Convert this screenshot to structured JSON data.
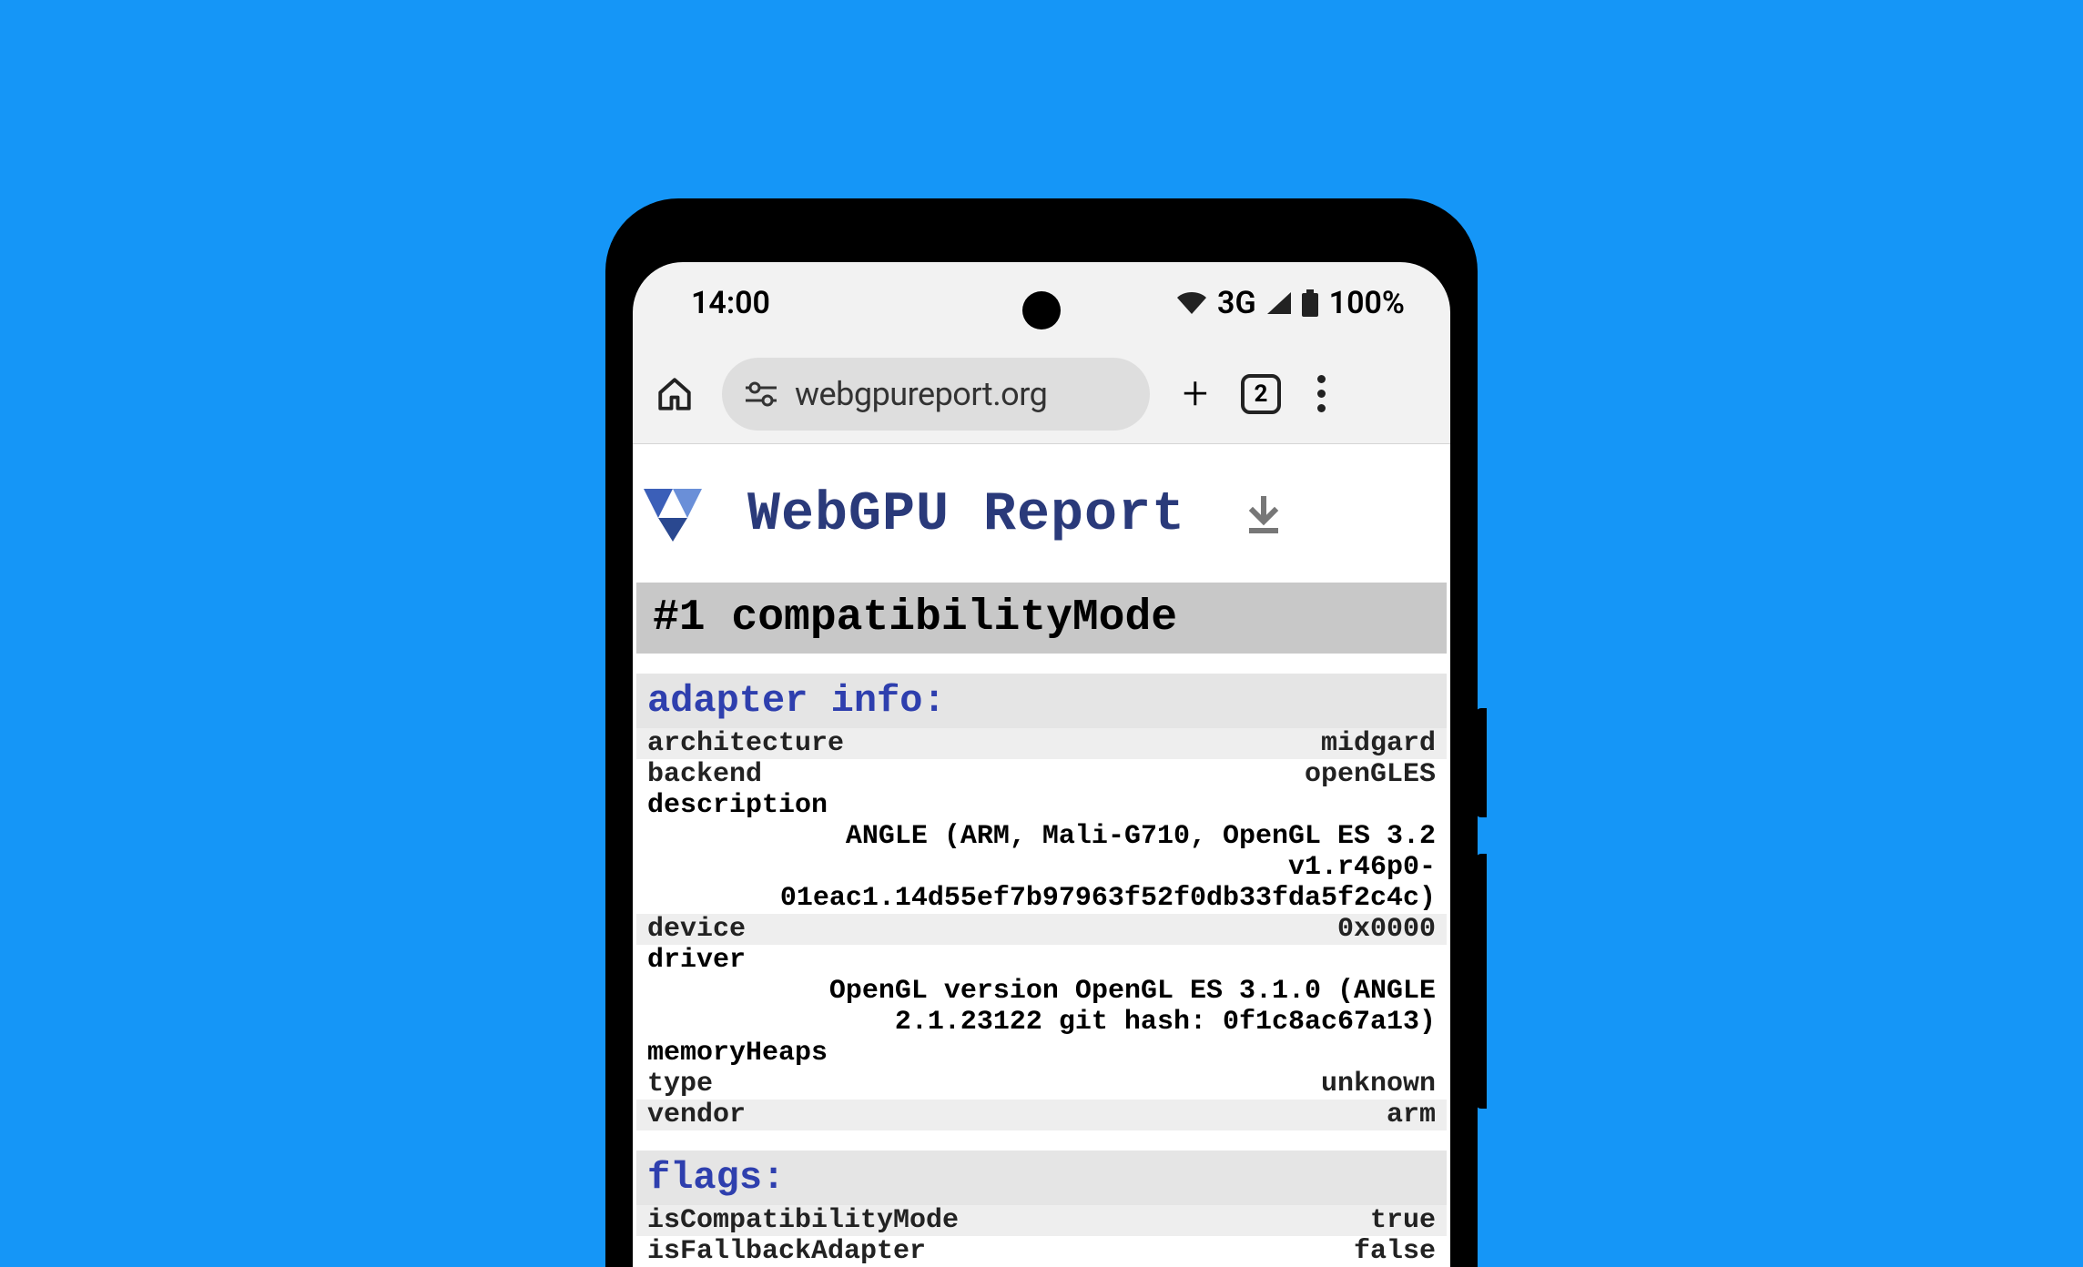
{
  "statusbar": {
    "time": "14:00",
    "network": "3G",
    "battery": "100%"
  },
  "toolbar": {
    "url": "webgpureport.org",
    "tab_count": "2"
  },
  "page": {
    "title": "WebGPU Report",
    "section_title": "#1 compatibilityMode",
    "adapter_heading": "adapter info:",
    "flags_heading": "flags:"
  },
  "adapter": {
    "architecture_k": "architecture",
    "architecture_v": "midgard",
    "backend_k": "backend",
    "backend_v": "openGLES",
    "description_k": "description",
    "description_v": "ANGLE (ARM, Mali-G710, OpenGL ES 3.2 v1.r46p0-01eac1.14d55ef7b97963f52f0db33fda5f2c4c)",
    "device_k": "device",
    "device_v": "0x0000",
    "driver_k": "driver",
    "driver_v": "OpenGL version OpenGL ES 3.1.0 (ANGLE 2.1.23122 git hash: 0f1c8ac67a13)",
    "memoryHeaps_k": "memoryHeaps",
    "type_k": "type",
    "type_v": "unknown",
    "vendor_k": "vendor",
    "vendor_v": "arm"
  },
  "flags": {
    "isCompatibilityMode_k": "isCompatibilityMode",
    "isCompatibilityMode_v": "true",
    "isFallbackAdapter_k": "isFallbackAdapter",
    "isFallbackAdapter_v": "false"
  }
}
